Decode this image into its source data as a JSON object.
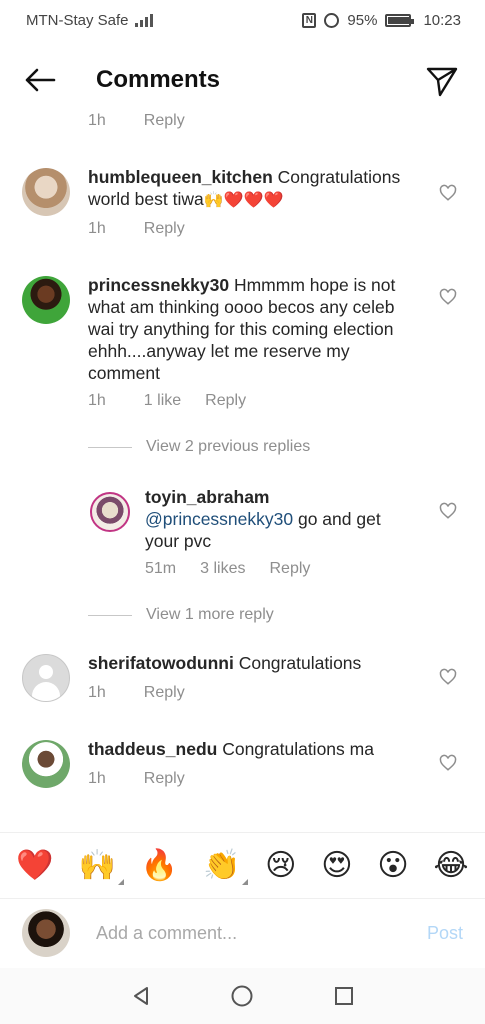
{
  "status_bar": {
    "carrier": "MTN-Stay Safe",
    "battery": "95%",
    "time": "10:23"
  },
  "header": {
    "title": "Comments"
  },
  "comments": [
    {
      "meta_time": "1h",
      "reply_label": "Reply"
    },
    {
      "username": "humblequeen_kitchen",
      "text": "Congratulations world best tiwa",
      "emojis": "🙌❤️❤️❤️",
      "time": "1h",
      "reply_label": "Reply"
    },
    {
      "username": "princessnekky30",
      "text": "Hmmmm hope is not what am thinking oooo becos any celeb wai try anything for this coming election ehhh....anyway let me reserve my comment",
      "time": "1h",
      "likes": "1 like",
      "reply_label": "Reply",
      "view_previous": "View 2 previous replies",
      "reply": {
        "username": "toyin_abraham",
        "mention": "@princessnekky30",
        "text": "go and get your pvc",
        "time": "51m",
        "likes": "3 likes",
        "reply_label": "Reply"
      },
      "view_more": "View 1 more reply"
    },
    {
      "username": "sherifatowodunni",
      "text": "Congratulations",
      "time": "1h",
      "reply_label": "Reply"
    },
    {
      "username": "thaddeus_nedu",
      "text": "Congratulations ma",
      "time": "1h",
      "reply_label": "Reply"
    }
  ],
  "emoji_bar": [
    "❤️",
    "🙌",
    "🔥",
    "👏",
    "😢",
    "😍",
    "😮",
    "😂"
  ],
  "input": {
    "placeholder": "Add a comment...",
    "post_label": "Post"
  },
  "colors": {
    "text": "#262626",
    "muted": "#8e8e8e",
    "mention": "#1f4e79",
    "post_disabled": "#b3d7f7"
  }
}
